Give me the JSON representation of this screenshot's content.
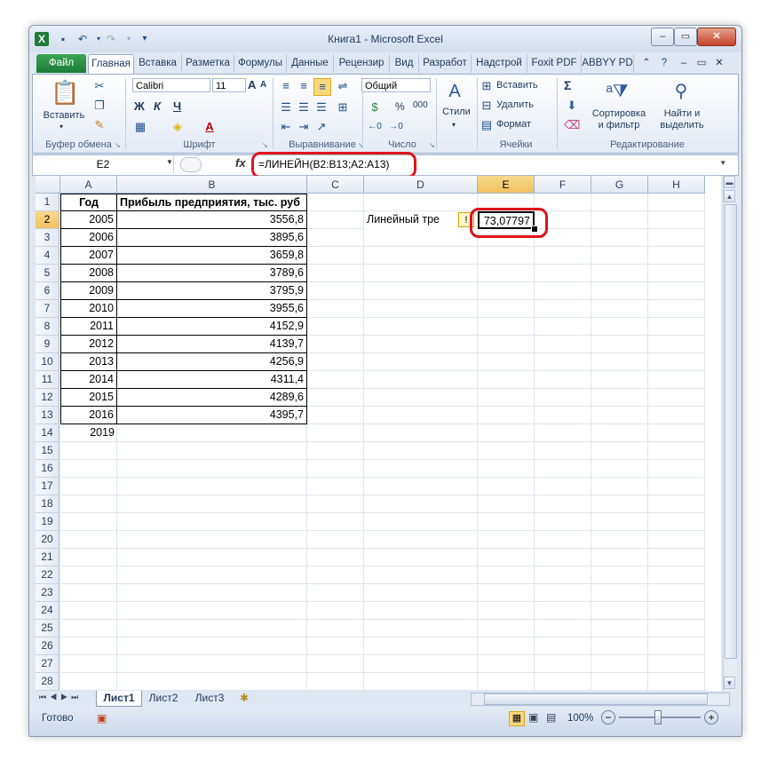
{
  "window": {
    "title": "Книга1  -  Microsoft Excel",
    "buttons": {
      "minimize": "–",
      "maximize": "▭",
      "close": "✕"
    }
  },
  "qat": {
    "save_icon": "save-icon",
    "undo_icon": "undo-icon",
    "redo_icon": "redo-icon"
  },
  "tabs": [
    "Файл",
    "Главная",
    "Вставка",
    "Разметка",
    "Формулы",
    "Данные",
    "Рецензир",
    "Вид",
    "Разработ",
    "Надстрой",
    "Foxit PDF",
    "ABBYY PD"
  ],
  "ribbon": {
    "clipboard": {
      "paste": "Вставить",
      "label": "Буфер обмена"
    },
    "font": {
      "name": "Calibri",
      "size": "11",
      "bold": "Ж",
      "italic": "К",
      "underline": "Ч",
      "label": "Шрифт",
      "grow": "A",
      "shrink": "A"
    },
    "alignment": {
      "label": "Выравнивание"
    },
    "number": {
      "format": "Общий",
      "percent": "%",
      "thousands": "000",
      "label": "Число"
    },
    "styles": {
      "label": "Стили"
    },
    "cells": {
      "insert": "Вставить",
      "delete": "Удалить",
      "format": "Формат",
      "label": "Ячейки"
    },
    "editing": {
      "sort": "Сортировка",
      "sort2": "и фильтр",
      "find": "Найти и",
      "find2": "выделить",
      "label": "Редактирование",
      "sum": "Σ"
    }
  },
  "formula_bar": {
    "name_box": "E2",
    "fx": "fx",
    "formula": "=ЛИНЕЙН(B2:B13;A2:A13)"
  },
  "columns": [
    "A",
    "B",
    "C",
    "D",
    "E",
    "F",
    "G",
    "H"
  ],
  "rows": [
    "1",
    "2",
    "3",
    "4",
    "5",
    "6",
    "7",
    "8",
    "9",
    "10",
    "11",
    "12",
    "13",
    "14",
    "15",
    "16",
    "17",
    "18",
    "19",
    "20",
    "21",
    "22",
    "23",
    "24",
    "25",
    "26",
    "27",
    "28"
  ],
  "table": {
    "header_a": "Год",
    "header_b": "Прибыль предприятия, тыс. руб",
    "years": [
      "2005",
      "2006",
      "2007",
      "2008",
      "2009",
      "2010",
      "2011",
      "2012",
      "2013",
      "2014",
      "2015",
      "2016",
      "2019"
    ],
    "profits": [
      "3556,8",
      "3895,6",
      "3659,8",
      "3789,6",
      "3795,9",
      "3955,6",
      "4152,9",
      "4139,7",
      "4256,9",
      "4311,4",
      "4289,6",
      "4395,7"
    ]
  },
  "d2_text": "Линейный тре",
  "e2_value": "73,07797",
  "sheets": [
    "Лист1",
    "Лист2",
    "Лист3"
  ],
  "status": {
    "ready": "Готово",
    "zoom": "100%",
    "minus": "−",
    "plus": "+"
  }
}
